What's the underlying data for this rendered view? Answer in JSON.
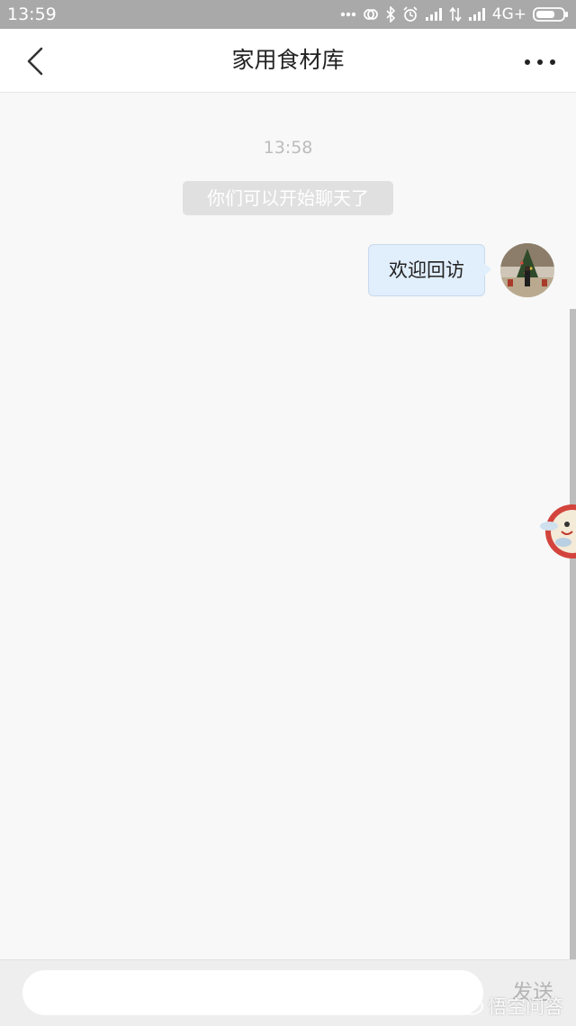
{
  "status_bar": {
    "time": "13:59",
    "network": "4G+",
    "icons": [
      "more-dots-icon",
      "sync-icon",
      "bluetooth-icon",
      "alarm-icon",
      "signal-icon",
      "data-arrows-icon",
      "signal-icon",
      "battery-icon"
    ]
  },
  "header": {
    "title": "家用食材库",
    "back_icon": "chevron-left-icon",
    "more_icon": "more-horizontal-icon"
  },
  "chat": {
    "timestamp": "13:58",
    "system_notice": "你们可以开始聊天了",
    "messages": [
      {
        "sender": "self",
        "text": "欢迎回访"
      }
    ]
  },
  "input_bar": {
    "value": "",
    "placeholder": "",
    "send_label": "发送"
  },
  "watermark": {
    "text": "悟空问答"
  },
  "colors": {
    "status_bar_bg": "#a9a9a9",
    "bubble_bg": "#e1eefb",
    "notice_bg": "#e0e0e0",
    "page_bg": "#f8f8f8"
  }
}
